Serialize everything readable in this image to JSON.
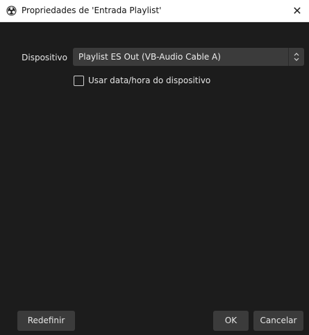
{
  "window": {
    "title": "Propriedades de 'Entrada Playlist'",
    "close_glyph": "✕",
    "app_icon": "obs-logo-icon"
  },
  "form": {
    "device_label": "Dispositivo",
    "device_value": "Playlist ES Out (VB-Audio Cable A)",
    "use_device_timestamp_label": "Usar data/hora do dispositivo",
    "use_device_timestamp_checked": false
  },
  "buttons": {
    "reset": "Redefinir",
    "ok": "OK",
    "cancel": "Cancelar"
  },
  "colors": {
    "background": "#1c1c1c",
    "titlebar": "#ffffff",
    "control": "#3b3b3b",
    "text": "#e6e6e6"
  }
}
